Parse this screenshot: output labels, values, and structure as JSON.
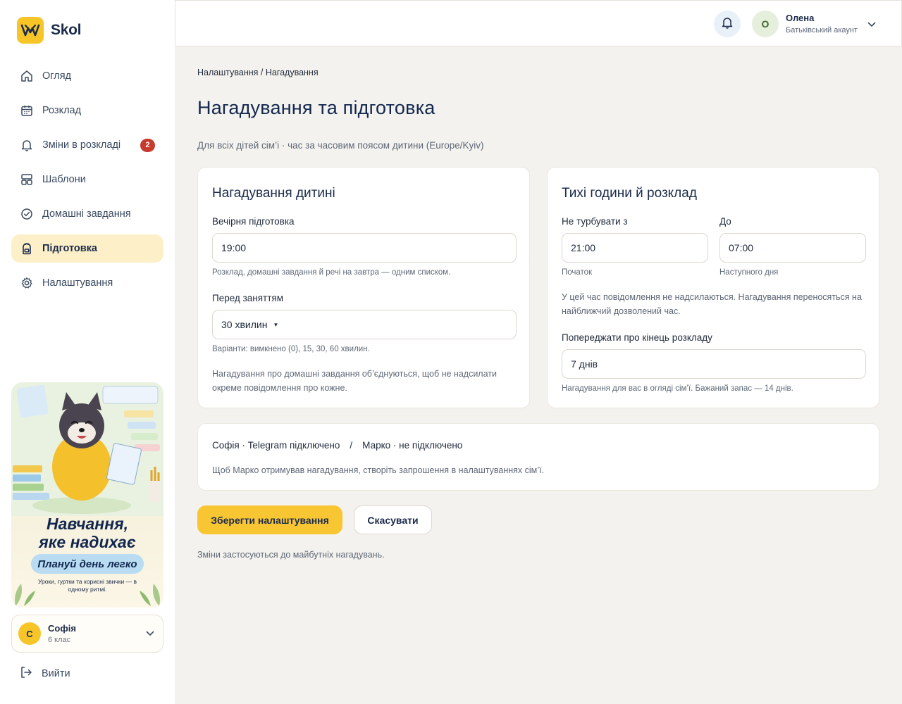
{
  "brand": {
    "name": "Skol",
    "accent": "#f7c528"
  },
  "sidebar": {
    "items": [
      {
        "label": "Огляд",
        "icon": "home-icon"
      },
      {
        "label": "Розклад",
        "icon": "calendar-icon"
      },
      {
        "label": "Зміни в розкладі",
        "icon": "bell-icon",
        "badge": "2"
      },
      {
        "label": "Шаблони",
        "icon": "templates-icon"
      },
      {
        "label": "Домашні завдання",
        "icon": "check-circle-icon"
      },
      {
        "label": "Підготовка",
        "icon": "backpack-icon",
        "active": true
      },
      {
        "label": "Налаштування",
        "icon": "gear-icon"
      }
    ],
    "promo": {
      "title_line1": "Навчання,",
      "title_line2": "яке надихає",
      "pill": "Плануй день легко",
      "subtitle": "Уроки, гуртки та корисні звички — в одному ритмі."
    },
    "child": {
      "initial": "С",
      "name": "Софія",
      "grade": "6 клас"
    },
    "logout_label": "Вийти"
  },
  "header": {
    "user": {
      "initial": "О",
      "name": "Олена",
      "role": "Батьківський акаунт"
    }
  },
  "main": {
    "breadcrumb": "Налаштування / Нагадування",
    "title": "Нагадування та підготовка",
    "subtitle": "Для всіх дітей сім’і · час за часовим поясом дитини (Europe/Kyiv)",
    "child_reminders": {
      "title": "Нагадування дитині",
      "evening_label": "Вечірня підготовка",
      "evening_value": "19:00",
      "evening_hint": "Розклад, домашні завдання й речі на завтра — одним списком.",
      "before_label": "Перед заняттям",
      "before_value": "30 хвилин",
      "before_hint": "Варіанти: вимкнено (0), 15, 30, 60 хвилин.",
      "note": "Нагадування про домашні завдання об’єднуються, щоб не надсилати окреме повідомлення про кожне."
    },
    "quiet_hours": {
      "title": "Тихі години й розклад",
      "from_label": "Не турбувати з",
      "from_value": "21:00",
      "from_hint": "Початок",
      "to_label": "До",
      "to_value": "07:00",
      "to_hint": "Наступного дня",
      "note": "У цей час повідомлення не надсилаються. Нагадування переносяться на найближчий дозволений час.",
      "warn_label": "Попереджати про кінець розкладу",
      "warn_value": "7 днів",
      "warn_hint": "Нагадування для вас в огляді сім’ї. Бажаний запас — 14 днів."
    },
    "telegram": {
      "status1": "Софія · Telegram підключено",
      "separator": "/",
      "status2": "Марко · не підключено",
      "note": "Щоб Марко отримував нагадування, створіть запрошення в налаштуваннях сім’ї."
    },
    "save_label": "Зберегти налаштування",
    "cancel_label": "Скасувати",
    "footer_note": "Зміни застосуються до майбутніх нагадувань."
  },
  "colors": {
    "primary": "#f8c533",
    "badge": "#c73a2e",
    "active_bg": "#fdf0c8",
    "title": "#13284f"
  }
}
